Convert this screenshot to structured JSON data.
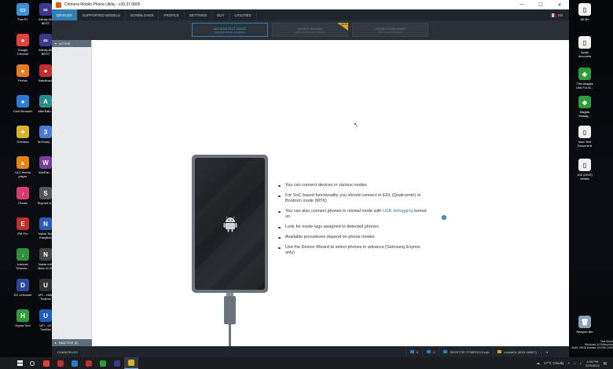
{
  "desktop": {
    "left_icons": [
      {
        "label": "This PC",
        "color": "#3a8fd6",
        "glyph": "▭"
      },
      {
        "label": "Infinity-Bo\nBEST",
        "color": "#3b3b8a",
        "glyph": "∞"
      },
      {
        "label": "Google\nChrome",
        "color": "#e34133",
        "glyph": "●"
      },
      {
        "label": "Infinity-Bo\nBEST",
        "color": "#3b3b8a",
        "glyph": "∞"
      },
      {
        "label": "Firefox",
        "color": "#e8791f",
        "glyph": "●"
      },
      {
        "label": "Bandicam",
        "color": "#c22d2d",
        "glyph": "●"
      },
      {
        "label": "Cent Browser",
        "color": "#2a7bd4",
        "glyph": "●"
      },
      {
        "label": "AfterSale...",
        "color": "#2a8c8c",
        "glyph": "A"
      },
      {
        "label": "Chimera",
        "color": "#d8b22a",
        "glyph": "✦"
      },
      {
        "label": "3uTools(…)",
        "color": "#4a7bd0",
        "glyph": "3"
      },
      {
        "label": "VLC media\nplayer",
        "color": "#e8830e",
        "glyph": "▲"
      },
      {
        "label": "WinRar-...",
        "color": "#7a3c9c",
        "glyph": "W"
      },
      {
        "label": "iTunes",
        "color": "#d63b6e",
        "glyph": "♪"
      },
      {
        "label": "Skymet U...",
        "color": "#555",
        "glyph": "S"
      },
      {
        "label": "EM Pro",
        "color": "#c22d2d",
        "glyph": "E"
      },
      {
        "label": "Nokia Tool\nEasyBox",
        "color": "#2a5bb8",
        "glyph": "N"
      },
      {
        "label": "Internet\nDownlo...",
        "color": "#2f8f3a",
        "glyph": "↓"
      },
      {
        "label": "Nokia Info\nBest v2.29",
        "color": "#444",
        "glyph": "N"
      },
      {
        "label": "DC Unlocker",
        "color": "#2c4a9c",
        "glyph": "D"
      },
      {
        "label": "UFI - eMM\nToolbox",
        "color": "#333",
        "glyph": "U"
      },
      {
        "label": "Hydra Tool",
        "color": "#2f9c3a",
        "glyph": "H"
      },
      {
        "label": "UFI - UF\nToolBox",
        "color": "#1d5fbf",
        "glyph": "U"
      }
    ],
    "right_icons": [
      {
        "label": "All Me",
        "color": "#f2f2f2",
        "glyph": "▯"
      },
      {
        "label": "Apple\nAccounts",
        "color": "#f2f2f2",
        "glyph": "▯"
      },
      {
        "label": "This Magisk\nUse For Al...",
        "color": "#2f9c3a",
        "glyph": "◆"
      },
      {
        "label": "Magisk\nManag...",
        "color": "#2f9c3a",
        "glyph": "◆"
      },
      {
        "label": "New Text\nDocument",
        "color": "#f2f2f2",
        "glyph": "▯"
      },
      {
        "label": "105 (2019)\ndetails",
        "color": "#f2f2f2",
        "glyph": "▯"
      },
      {
        "label": "Recycle Bin",
        "color": "#8aa0b8",
        "glyph": "🗑"
      }
    ],
    "watermark": "Test Mode\nWindows 10 Enterprise\nBuild 19045 release.191206-1406"
  },
  "window": {
    "title": "Chimera Mobile Phone Utility - v30.37.0805",
    "controls": {
      "minimize": "—",
      "maximize": "☐",
      "close": "✕"
    }
  },
  "menu": {
    "items": [
      "DEVICES",
      "SUPPORTED MODELS",
      "DOWNLOADS",
      "PROFILE",
      "SETTINGS",
      "BUY",
      "UTILITIES"
    ],
    "language": "EN"
  },
  "modes": [
    {
      "label": "AUTO DETECT MODE",
      "sub": "Automatic device recognition"
    },
    {
      "label": "DEVICE WIZARD",
      "sub": "Step by step device selection",
      "badge": "BETA"
    },
    {
      "label": "CONNECTION GUIDE",
      "sub": "How to connect devices"
    }
  ],
  "sidebar": {
    "active_header": "ACTIVE",
    "inactive_footer": "INACTIVE (0)"
  },
  "tips": [
    {
      "text": "You can connect devices in various modes"
    },
    {
      "text": "For SoC based functionality you should connect in EDL (Qualcomm) or Bootrom mode (MTK)"
    },
    {
      "pre": "You can also connect phones in normal mode with ",
      "link": "USB debugging",
      "post": " turned on"
    },
    {
      "text": "Look for mode tags assigned to detected phones"
    },
    {
      "text": "Available procedures depend on phone modes"
    },
    {
      "text": "Use the Device Wizard to select phones in advance (Samsung Exynos only)"
    }
  ],
  "help_icon": "?",
  "status": {
    "changelog": "CHANGELOG",
    "count_a": "0",
    "count_b": "0",
    "host": "DESKTOP-7F36FEG.01eab",
    "user": "mostal04 (6001-68527)"
  },
  "taskbar": {
    "weather": "17°C Cloudy",
    "time": "4:04 PM",
    "date": "2/29/2024",
    "apps": [
      {
        "name": "search",
        "color": "#ddd"
      },
      {
        "name": "chrome",
        "color": "#e34133"
      },
      {
        "name": "bandicam",
        "color": "#c22d2d"
      },
      {
        "name": "cent-browser",
        "color": "#2a7bd4"
      },
      {
        "name": "record",
        "color": "#c22d2d"
      },
      {
        "name": "hydra",
        "color": "#2f9c3a"
      },
      {
        "name": "infinity",
        "color": "#3b3b8a"
      },
      {
        "name": "chimera",
        "color": "#d8b22a",
        "active": true
      }
    ]
  }
}
